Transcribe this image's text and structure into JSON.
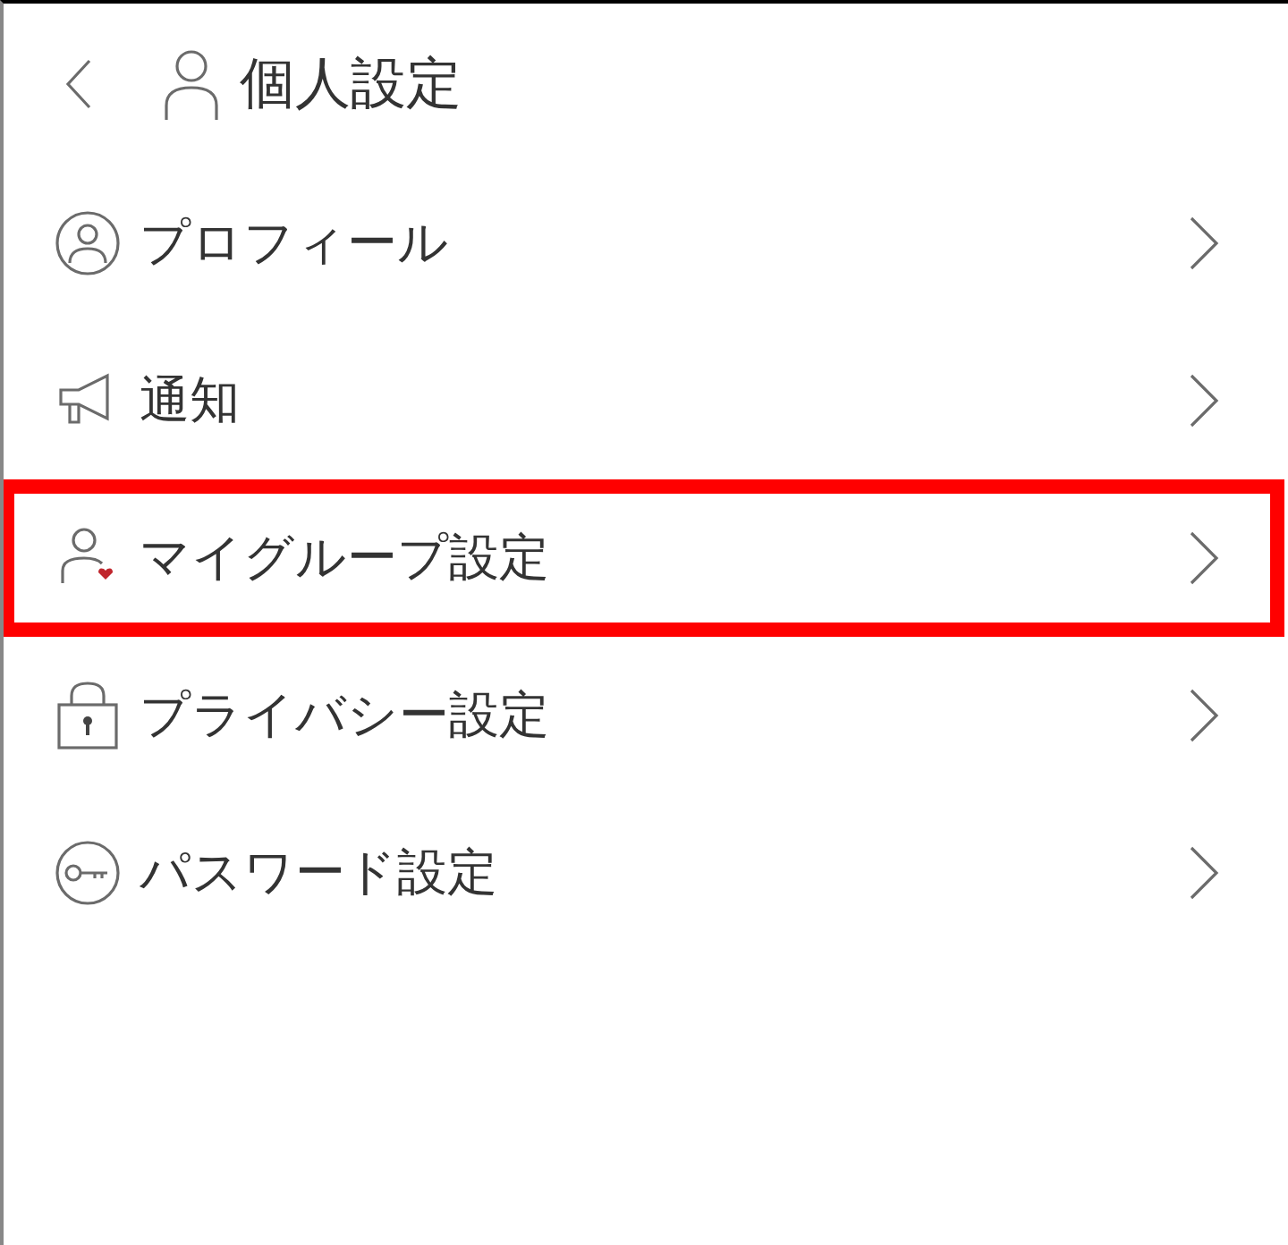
{
  "header": {
    "title": "個人設定"
  },
  "menu": [
    {
      "kind": "profile",
      "label": "プロフィール",
      "highlighted": false
    },
    {
      "kind": "notice",
      "label": "通知",
      "highlighted": false
    },
    {
      "kind": "group",
      "label": "マイグループ設定",
      "highlighted": true
    },
    {
      "kind": "privacy",
      "label": "プライバシー設定",
      "highlighted": false
    },
    {
      "kind": "password",
      "label": "パスワード設定",
      "highlighted": false
    }
  ]
}
